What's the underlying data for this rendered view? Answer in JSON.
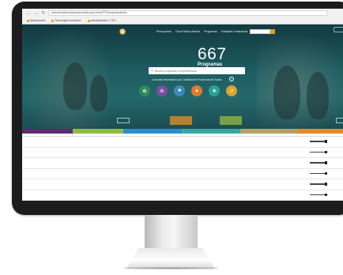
{
  "browser": {
    "url": "www.transparenciapresupuestaria.gob.mx/es/PTP/programas#inicio",
    "bookmarks": [
      "Aplicaciones",
      "Tecnología Innovación",
      "Administración / TEU"
    ]
  },
  "hero": {
    "nav": [
      "Presupuesto",
      "Obra Pública Abierta",
      "Programas",
      "Entidades Federativas",
      "Datos Abiertos"
    ],
    "program_count": "667",
    "program_label": "Programas",
    "search_placeholder": "Buscar programas o dependencias",
    "hint": "Consulta información por Clasificación Funcional del Gasto",
    "tab_1": "",
    "tab_2": ""
  },
  "colors": {
    "hero_bg": "#1d5c62",
    "col_1": "#5a2d6e",
    "col_2": "#8cbc43",
    "col_3": "#2b8fc9",
    "col_4": "#3aa7a3",
    "col_5": "#b2a26a",
    "col_6": "#e08a2a"
  },
  "table": {
    "rows": [
      [
        "",
        "",
        "",
        "",
        "",
        ""
      ],
      [
        "",
        "",
        "",
        "",
        "",
        ""
      ],
      [
        "",
        "",
        "",
        "",
        "",
        ""
      ],
      [
        "",
        "",
        "",
        "",
        "",
        ""
      ],
      [
        "",
        "",
        "",
        "",
        "",
        ""
      ],
      [
        "",
        "",
        "",
        "",
        "",
        ""
      ]
    ]
  }
}
